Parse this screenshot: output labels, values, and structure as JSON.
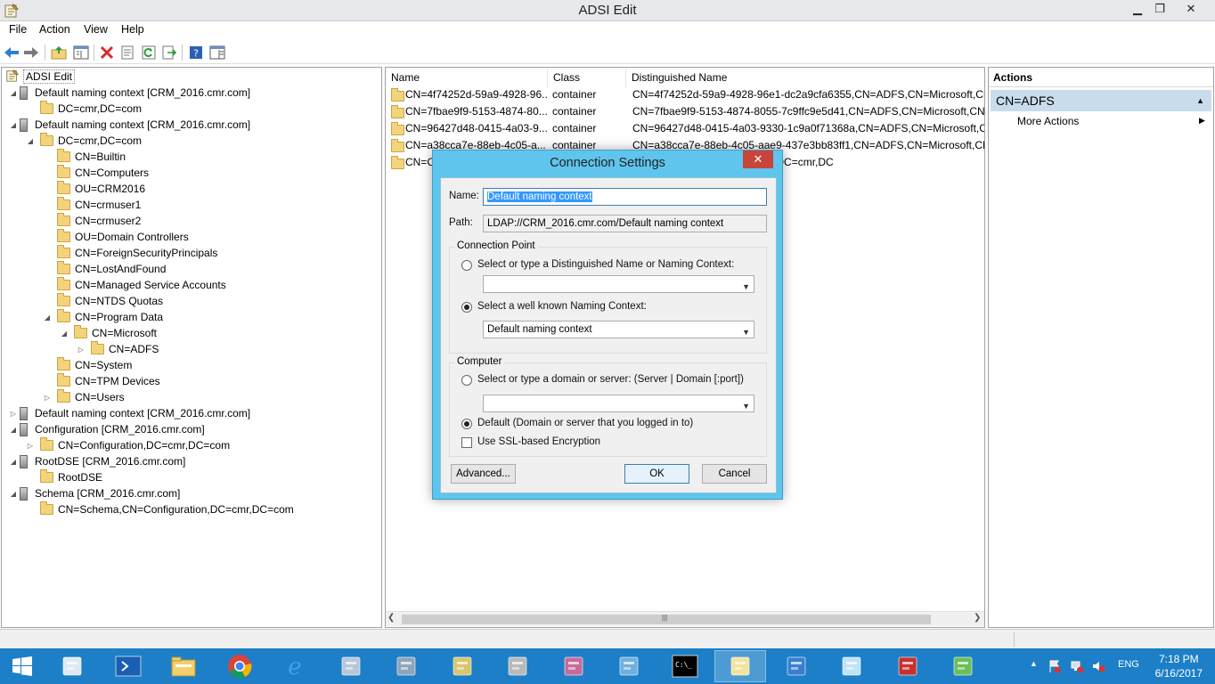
{
  "window": {
    "title": "ADSI Edit",
    "minimize_glyph": "▁",
    "restore_glyph": "❐",
    "close_glyph": "✕"
  },
  "menu": [
    "File",
    "Action",
    "View",
    "Help"
  ],
  "toolbar_icons": [
    "back-arrow-icon",
    "forward-arrow-icon",
    "up-folder-icon",
    "show-hide-tree-icon",
    "delete-icon",
    "properties-icon",
    "refresh-icon",
    "export-list-icon",
    "help-icon",
    "show-hide-action-pane-icon"
  ],
  "tree": [
    {
      "label": "ADSI Edit",
      "indent": 0,
      "icon": "adsi",
      "expander": ""
    },
    {
      "label": "Default naming context [CRM_2016.cmr.com]",
      "indent": 1,
      "icon": "server",
      "expander": "◢"
    },
    {
      "label": "DC=cmr,DC=com",
      "indent": 2,
      "icon": "folder",
      "expander": ""
    },
    {
      "label": "Default naming context [CRM_2016.cmr.com]",
      "indent": 1,
      "icon": "server",
      "expander": "◢"
    },
    {
      "label": "DC=cmr,DC=com",
      "indent": 2,
      "icon": "folder",
      "expander": "◢"
    },
    {
      "label": "CN=Builtin",
      "indent": 3,
      "icon": "folder",
      "expander": ""
    },
    {
      "label": "CN=Computers",
      "indent": 3,
      "icon": "folder",
      "expander": ""
    },
    {
      "label": "OU=CRM2016",
      "indent": 3,
      "icon": "folder",
      "expander": ""
    },
    {
      "label": "CN=crmuser1",
      "indent": 3,
      "icon": "folder",
      "expander": ""
    },
    {
      "label": "CN=crmuser2",
      "indent": 3,
      "icon": "folder",
      "expander": ""
    },
    {
      "label": "OU=Domain Controllers",
      "indent": 3,
      "icon": "folder",
      "expander": ""
    },
    {
      "label": "CN=ForeignSecurityPrincipals",
      "indent": 3,
      "icon": "folder",
      "expander": ""
    },
    {
      "label": "CN=LostAndFound",
      "indent": 3,
      "icon": "folder",
      "expander": ""
    },
    {
      "label": "CN=Managed Service Accounts",
      "indent": 3,
      "icon": "folder",
      "expander": ""
    },
    {
      "label": "CN=NTDS Quotas",
      "indent": 3,
      "icon": "folder",
      "expander": ""
    },
    {
      "label": "CN=Program Data",
      "indent": 3,
      "icon": "folder",
      "expander": "◢"
    },
    {
      "label": "CN=Microsoft",
      "indent": 4,
      "icon": "folder",
      "expander": "◢"
    },
    {
      "label": "CN=ADFS",
      "indent": 5,
      "icon": "folder",
      "expander": "▷"
    },
    {
      "label": "CN=System",
      "indent": 3,
      "icon": "folder",
      "expander": ""
    },
    {
      "label": "CN=TPM Devices",
      "indent": 3,
      "icon": "folder",
      "expander": ""
    },
    {
      "label": "CN=Users",
      "indent": 3,
      "icon": "folder",
      "expander": "▷"
    },
    {
      "label": "Default naming context [CRM_2016.cmr.com]",
      "indent": 1,
      "icon": "server",
      "expander": "▷"
    },
    {
      "label": "Configuration [CRM_2016.cmr.com]",
      "indent": 1,
      "icon": "server",
      "expander": "◢"
    },
    {
      "label": "CN=Configuration,DC=cmr,DC=com",
      "indent": 2,
      "icon": "folder",
      "expander": "▷"
    },
    {
      "label": "RootDSE [CRM_2016.cmr.com]",
      "indent": 1,
      "icon": "server",
      "expander": "◢"
    },
    {
      "label": "RootDSE",
      "indent": 2,
      "icon": "folder",
      "expander": ""
    },
    {
      "label": "Schema [CRM_2016.cmr.com]",
      "indent": 1,
      "icon": "server",
      "expander": "◢"
    },
    {
      "label": "CN=Schema,CN=Configuration,DC=cmr,DC=com",
      "indent": 2,
      "icon": "folder",
      "expander": ""
    }
  ],
  "list": {
    "columns": [
      "Name",
      "Class",
      "Distinguished Name"
    ],
    "rows": [
      {
        "name": "CN=4f74252d-59a9-4928-96...",
        "class": "container",
        "dn": "CN=4f74252d-59a9-4928-96e1-dc2a9cfa6355,CN=ADFS,CN=Microsoft,CN="
      },
      {
        "name": "CN=7fbae9f9-5153-4874-80...",
        "class": "container",
        "dn": "CN=7fbae9f9-5153-4874-8055-7c9ffc9e5d41,CN=ADFS,CN=Microsoft,CN="
      },
      {
        "name": "CN=96427d48-0415-4a03-9...",
        "class": "container",
        "dn": "CN=96427d48-0415-4a03-9330-1c9a0f71368a,CN=ADFS,CN=Microsoft,CN="
      },
      {
        "name": "CN=a38cca7e-88eb-4c05-a...",
        "class": "container",
        "dn": "CN=a38cca7e-88eb-4c05-aae9-437e3bb83ff1,CN=ADFS,CN=Microsoft,CN="
      },
      {
        "name": "CN=C",
        "class": "",
        "dn": "=Microsoft,CN=Program Data,DC=cmr,DC"
      }
    ]
  },
  "actions": {
    "header": "Actions",
    "selected": "CN=ADFS",
    "more_actions": "More Actions"
  },
  "dialog": {
    "title": "Connection Settings",
    "close_glyph": "✕",
    "name_label": "Name:",
    "name_value": "Default naming context",
    "path_label": "Path:",
    "path_value": "LDAP://CRM_2016.cmr.com/Default naming context",
    "connection_point_title": "Connection Point",
    "radio_dn_label": "Select or type a Distinguished Name or Naming Context:",
    "radio_dn_value": "",
    "radio_known_label": "Select a well known Naming Context:",
    "known_value": "Default naming context",
    "computer_title": "Computer",
    "radio_server_label": "Select or type a domain or server: (Server | Domain [:port])",
    "server_value": "",
    "radio_default_label": "Default (Domain or server that you logged in to)",
    "ssl_label": "Use SSL-based Encryption",
    "advanced_label": "Advanced...",
    "ok_label": "OK",
    "cancel_label": "Cancel"
  },
  "taskbar": {
    "start_icon": "windows-start-icon",
    "apps": [
      "server-manager-icon",
      "powershell-icon",
      "file-explorer-icon",
      "chrome-icon",
      "internet-explorer-icon",
      "settings-gears-icon",
      "server-tools-icon",
      "library-books-icon",
      "server-lock-icon",
      "certificate-icon",
      "remote-tools-icon",
      "command-prompt-icon",
      "adsi-edit-icon",
      "network-globe-icon",
      "notepad-icon",
      "toolbox-icon",
      "cubes-icon"
    ],
    "tray_lang": "ENG",
    "time": "7:18 PM",
    "date": "6/16/2017",
    "tray_caret": "▲"
  }
}
